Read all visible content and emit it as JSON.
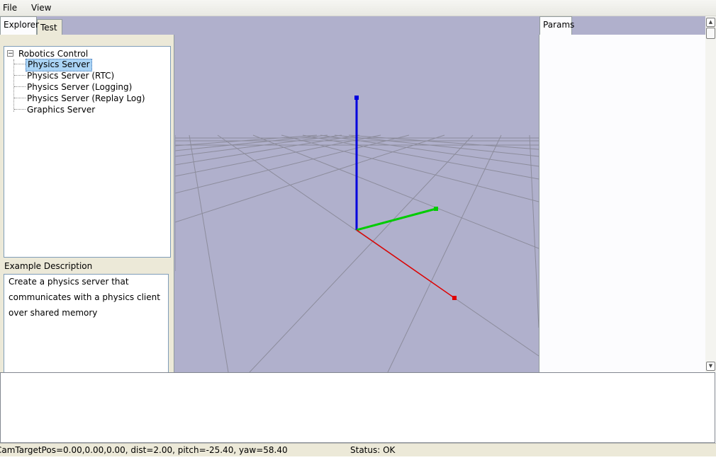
{
  "menu": {
    "file": "File",
    "view": "View"
  },
  "tabs": {
    "explorer": "Explorer",
    "test": "Test",
    "params": "Params"
  },
  "tree": {
    "root": "Robotics Control",
    "toggle": "−",
    "items": [
      "Physics Server",
      "Physics Server (RTC)",
      "Physics Server (Logging)",
      "Physics Server (Replay Log)",
      "Graphics Server"
    ]
  },
  "description": {
    "label": "Example Description",
    "lines": [
      "Create a physics server that",
      "communicates with a physics client",
      "over shared memory"
    ]
  },
  "status": {
    "camera": "CamTargetPos=0.00,0.00,0.00, dist=2.00, pitch=-25.40, yaw=58.40",
    "state": "Status: OK"
  },
  "colors": {
    "viewport_bg": "#b0b0cc",
    "axis_x": "#e00000",
    "axis_y": "#00cc00",
    "axis_z": "#0000dd",
    "grid": "#8c8c9c"
  }
}
